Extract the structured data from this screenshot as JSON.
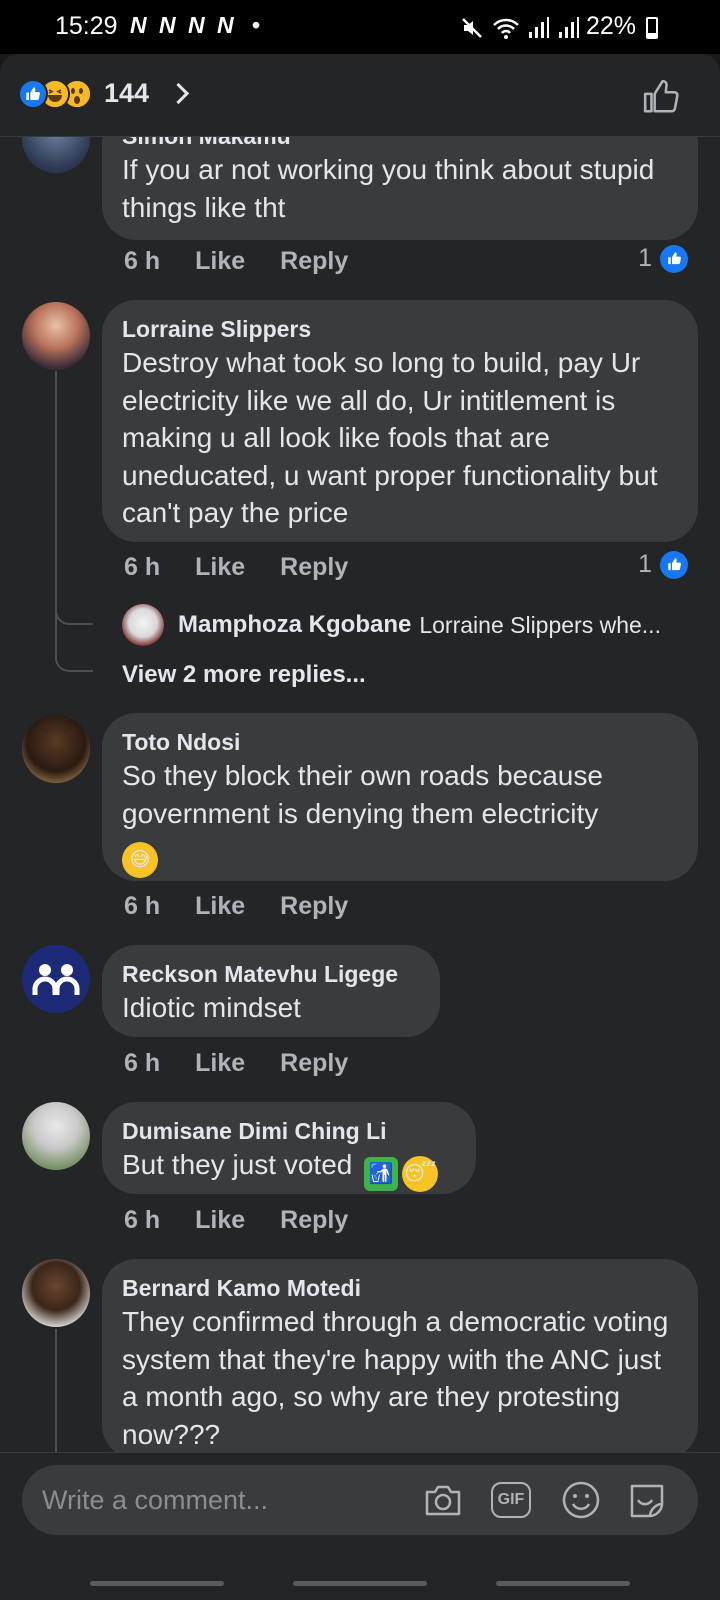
{
  "status_bar": {
    "time": "15:29",
    "notifications": "N N N N",
    "dot": "•",
    "battery": "22%",
    "battery_level": 0.22
  },
  "header": {
    "reaction_count": "144",
    "reaction_types": [
      "like",
      "haha",
      "wow"
    ]
  },
  "comments": [
    {
      "author": "Simon Makamu",
      "text": "If you ar not working you think about stupid things like tht",
      "time": "6 h",
      "like_label": "Like",
      "reply_label": "Reply",
      "likes": "1"
    },
    {
      "author": "Lorraine Slippers",
      "text": "Destroy what took so long to build, pay Ur electricity like we all do, Ur intitlement is making u all look like fools that are uneducated, u want proper functionality but can't pay the price",
      "time": "6 h",
      "like_label": "Like",
      "reply_label": "Reply",
      "likes": "1",
      "reply_preview": {
        "author": "Mamphoza Kgobane",
        "snippet": "Lorraine Slippers whe..."
      },
      "view_more": "View 2 more replies..."
    },
    {
      "author": "Toto Ndosi",
      "text": "So they block their own roads because government is denying them electricity",
      "emoji": "😅",
      "time": "6 h",
      "like_label": "Like",
      "reply_label": "Reply"
    },
    {
      "author": "Reckson Matevhu Ligege",
      "text": "Idiotic mindset",
      "time": "6 h",
      "like_label": "Like",
      "reply_label": "Reply"
    },
    {
      "author": "Dumisane Dimi Ching Li",
      "text": "But they just voted",
      "time": "6 h",
      "like_label": "Like",
      "reply_label": "Reply"
    },
    {
      "author": "Bernard Kamo Motedi",
      "text": "They confirmed through a democratic voting system that they're happy with the ANC just a month ago, so why are they protesting now???"
    }
  ],
  "composer": {
    "placeholder": "Write a comment...",
    "gif_label": "GIF"
  },
  "colors": {
    "background": "#242526",
    "bubble": "#3a3b3c",
    "accent": "#1877f2",
    "text": "#e4e6eb",
    "muted": "#b0b3b8"
  }
}
